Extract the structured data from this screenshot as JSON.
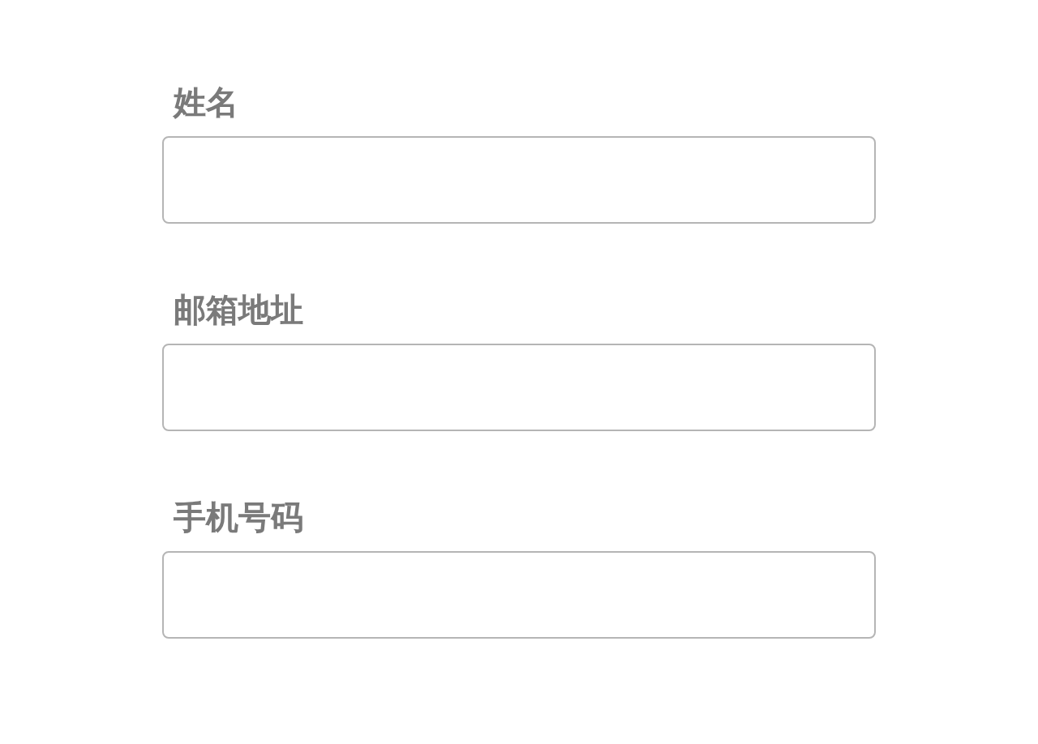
{
  "form": {
    "fields": [
      {
        "label": "姓名"
      },
      {
        "label": "邮箱地址"
      },
      {
        "label": "手机号码"
      }
    ]
  }
}
